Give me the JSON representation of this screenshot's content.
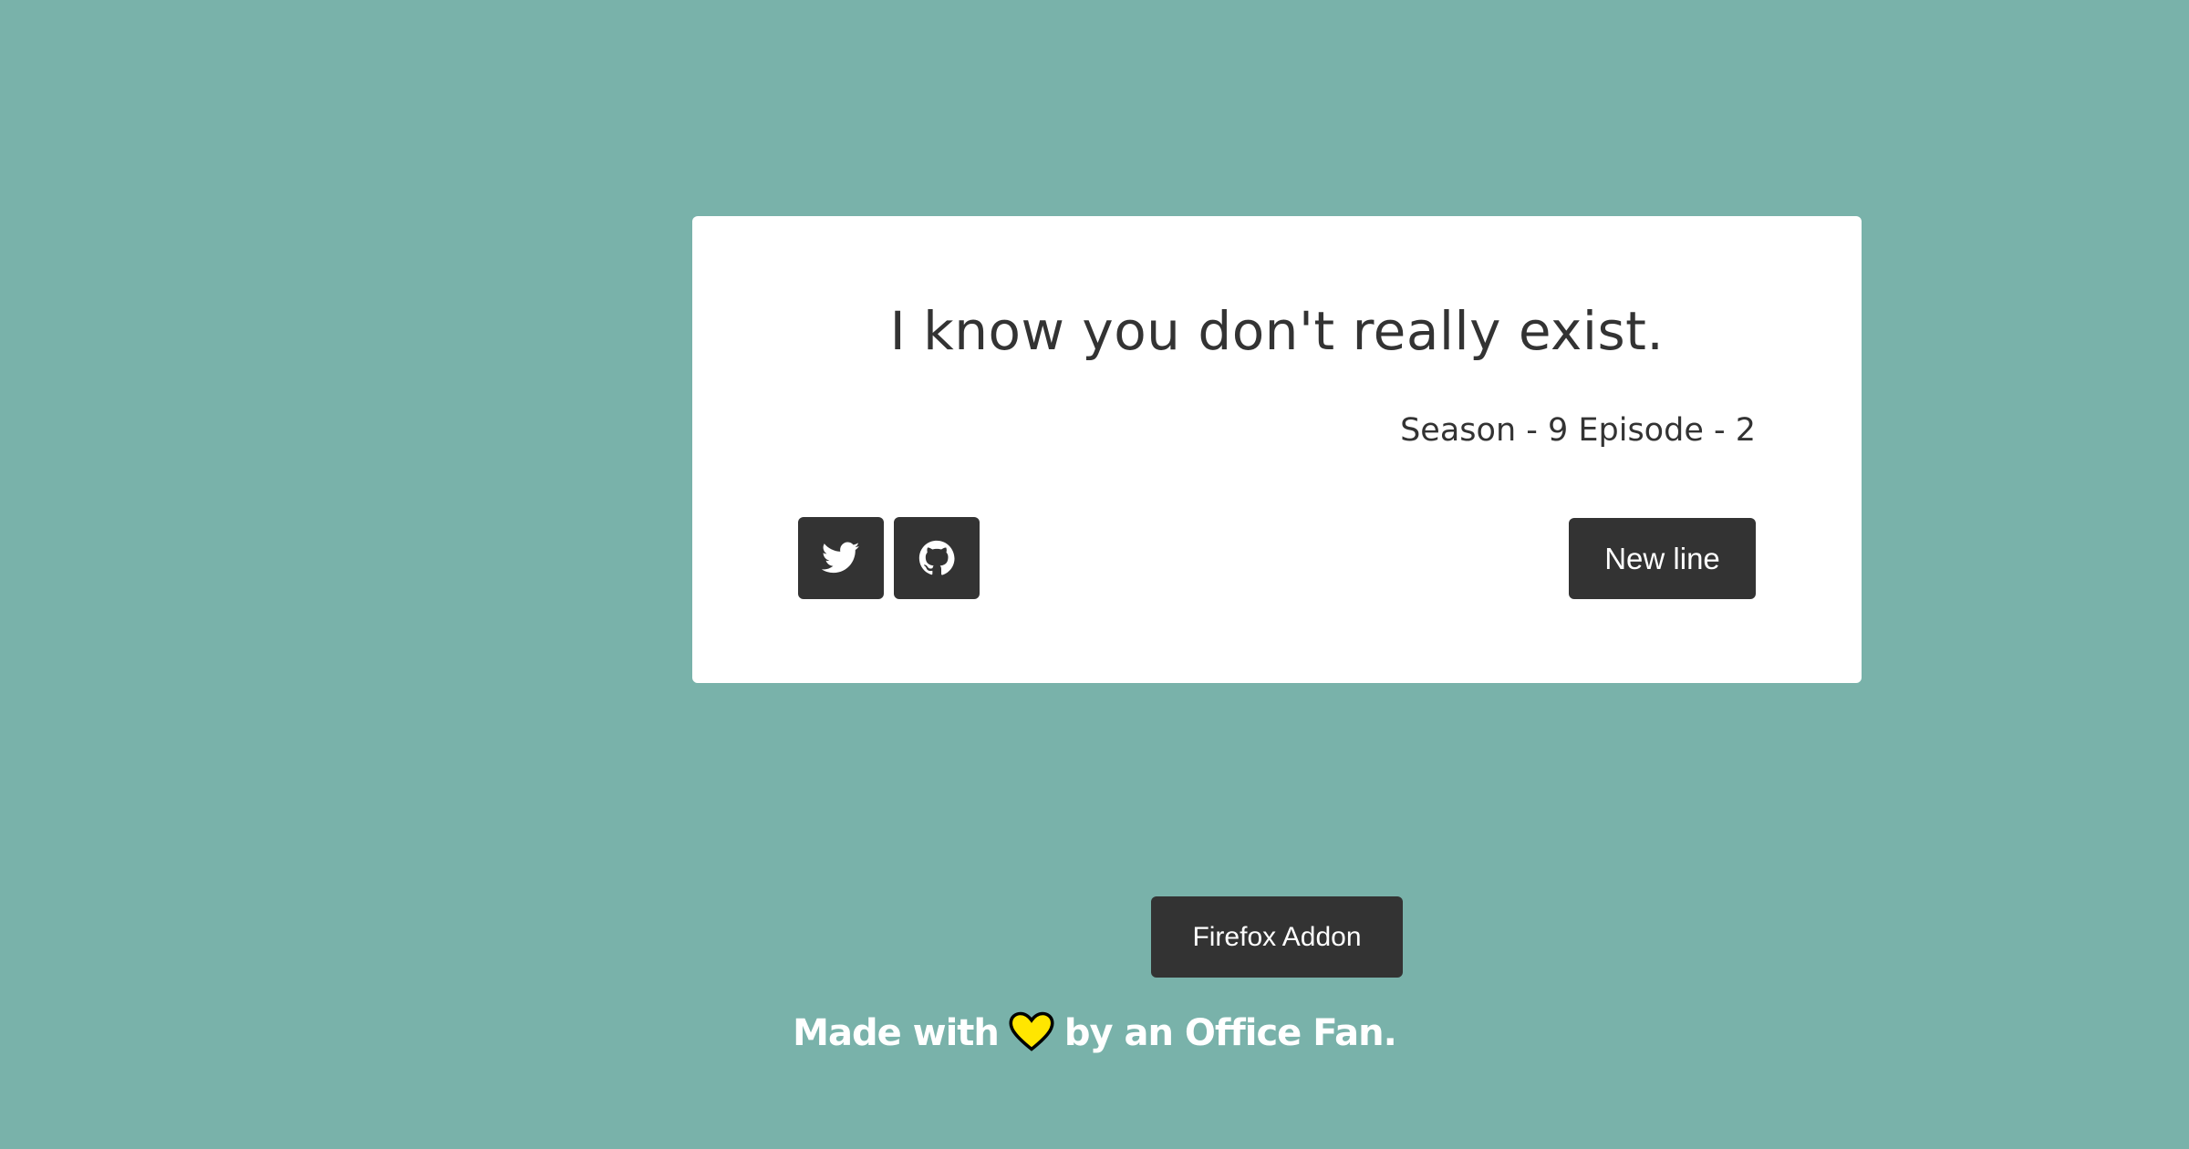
{
  "quote": {
    "text": "I know you don't really exist.",
    "episode": "Season - 9 Episode - 2"
  },
  "actions": {
    "twitter_icon": "twitter-icon",
    "github_icon": "github-icon",
    "new_line_label": "New line"
  },
  "addon": {
    "label": "Firefox Addon"
  },
  "footer": {
    "made_with": "Made with",
    "by": "by an Office Fan.",
    "heart_icon": "heart-icon"
  },
  "colors": {
    "background": "#79b2aa",
    "card": "#ffffff",
    "dark": "#333333",
    "heart": "#ffe600"
  }
}
